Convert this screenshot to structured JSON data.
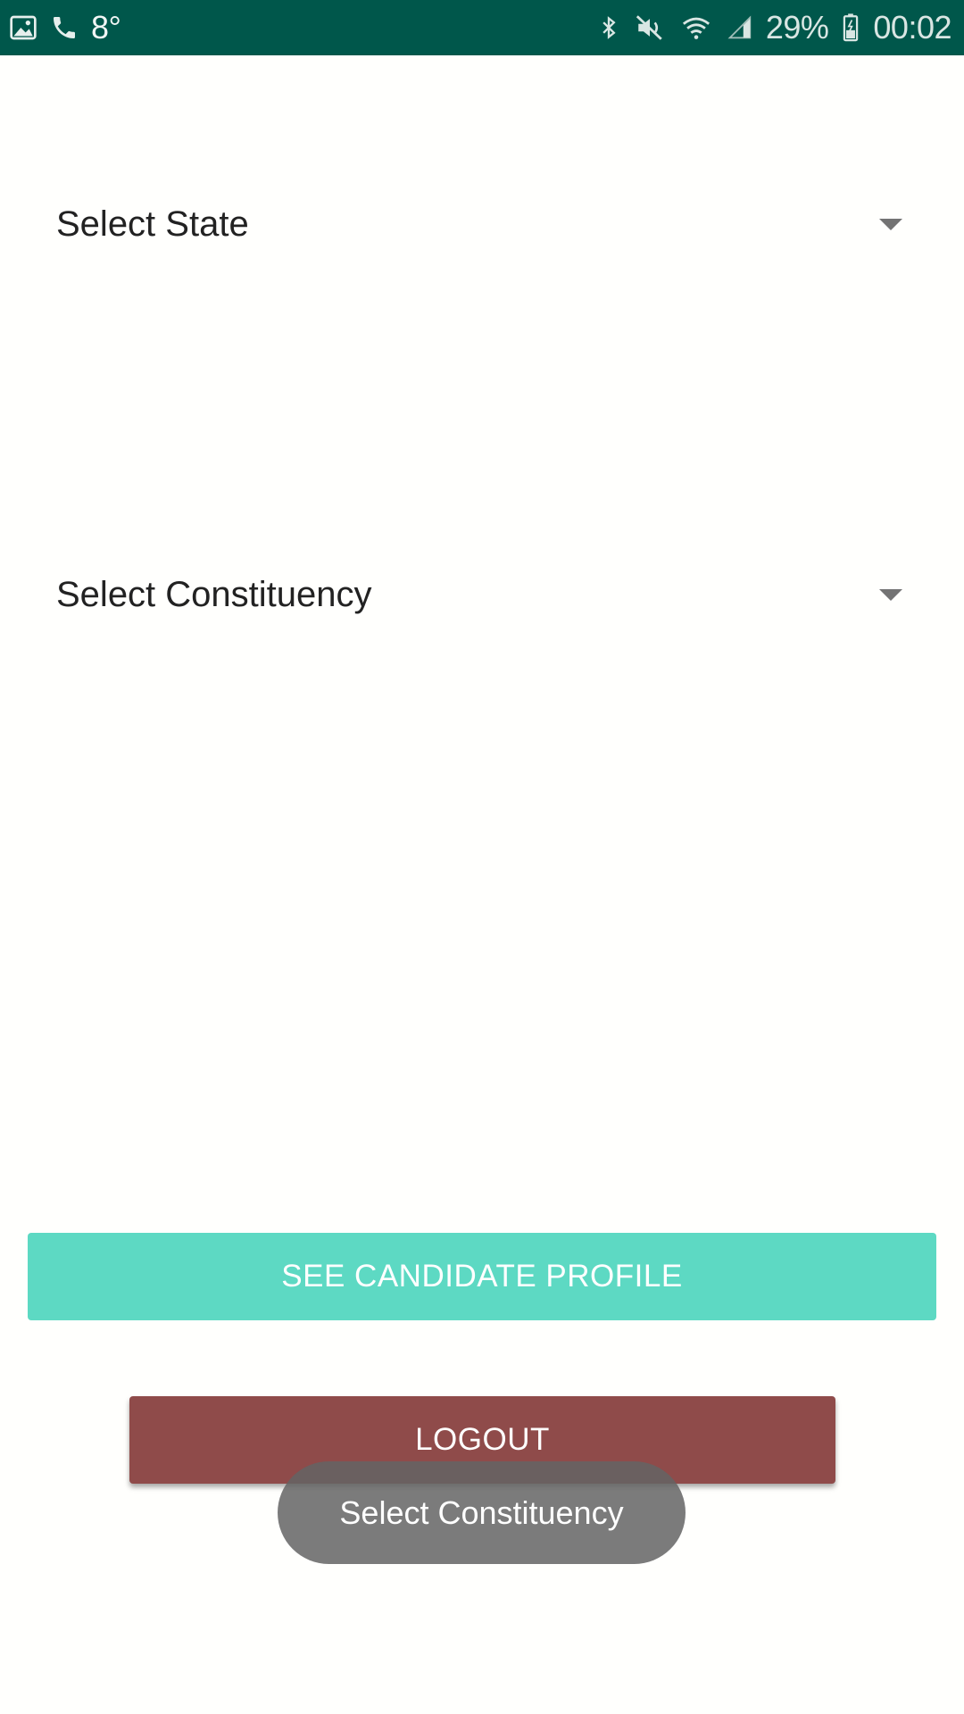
{
  "status_bar": {
    "temperature": "8°",
    "battery_percent": "29%",
    "time": "00:02",
    "background_color": "#00574b",
    "left_icons": [
      "gallery-icon",
      "phone-icon"
    ],
    "right_icons": [
      "bluetooth-icon",
      "mute-icon",
      "wifi-icon",
      "signal-icon",
      "battery-icon"
    ]
  },
  "form": {
    "state_spinner_label": "Select State",
    "constituency_spinner_label": "Select Constituency"
  },
  "buttons": {
    "candidate_profile_label": "SEE CANDIDATE PROFILE",
    "candidate_profile_color": "#5dd9c3",
    "logout_label": "LOGOUT",
    "logout_color": "#8f4b4a"
  },
  "toast": {
    "message": "Select Constituency"
  }
}
